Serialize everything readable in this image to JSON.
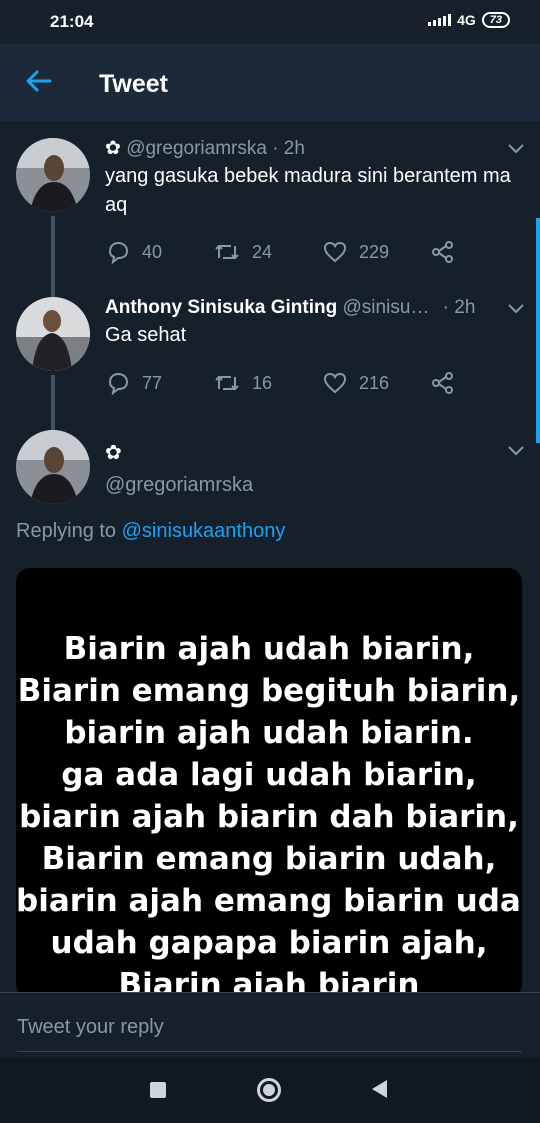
{
  "status": {
    "time": "21:04",
    "network": "4G",
    "battery": "73"
  },
  "header": {
    "title": "Tweet"
  },
  "tweets": [
    {
      "handle": "@gregoriamrska",
      "time": "· 2h",
      "text": "yang gasuka bebek madura sini berantem ma aq",
      "replies": "40",
      "retweets": "24",
      "likes": "229"
    },
    {
      "name": "Anthony Sinisuka Ginting",
      "handle": "@sinisu…",
      "time": "· 2h",
      "text": "Ga sehat",
      "replies": "77",
      "retweets": "16",
      "likes": "216"
    },
    {
      "handle": "@gregoriamrska"
    }
  ],
  "replying": {
    "prefix": "Replying to ",
    "handle": "@sinisukaanthony"
  },
  "media": {
    "lines": [
      "Biarin ajah udah biarin,",
      "Biarin emang begituh biarin,",
      "biarin ajah udah biarin.",
      "ga ada lagi udah biarin,",
      "biarin ajah biarin dah biarin,",
      "Biarin emang biarin udah,",
      "biarin ajah emang biarin udah,",
      "udah gapapa biarin ajah,",
      "Biarin ajah biarin"
    ]
  },
  "reply_box": {
    "placeholder": "Tweet your reply"
  },
  "colors": {
    "background": "#15202b",
    "accent": "#1da1f2",
    "muted": "#8899a6"
  }
}
